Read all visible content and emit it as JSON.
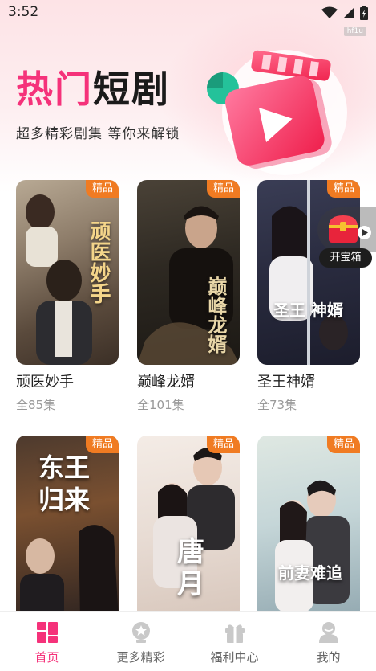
{
  "status_bar": {
    "time": "3:52",
    "badge": "hf1u"
  },
  "hero": {
    "title_hot": "热门",
    "title_rest": "短剧",
    "subtitle": "超多精彩剧集 等你来解锁"
  },
  "dramas": [
    {
      "title": "顽医妙手",
      "episodes": "全85集",
      "tag": "精品",
      "poster_text": "顽医妙手"
    },
    {
      "title": "巅峰龙婿",
      "episodes": "全101集",
      "tag": "精品",
      "poster_text": "巅峰龙婿"
    },
    {
      "title": "圣王神婿",
      "episodes": "全73集",
      "tag": "精品",
      "poster_text": "圣王 神婿"
    },
    {
      "title": "",
      "episodes": "",
      "tag": "精品",
      "poster_text": "东王归来"
    },
    {
      "title": "",
      "episodes": "",
      "tag": "精品",
      "poster_text": "唐月"
    },
    {
      "title": "",
      "episodes": "",
      "tag": "精品",
      "poster_text": "前妻难追"
    }
  ],
  "treasure": {
    "label": "开宝箱"
  },
  "bottom_nav": [
    {
      "label": "首页",
      "icon": "home-icon",
      "active": true
    },
    {
      "label": "更多精彩",
      "icon": "more-icon",
      "active": false
    },
    {
      "label": "福利中心",
      "icon": "gift-icon",
      "active": false
    },
    {
      "label": "我的",
      "icon": "profile-icon",
      "active": false
    }
  ],
  "colors": {
    "accent": "#f5327a",
    "tag": "#f07b22"
  }
}
